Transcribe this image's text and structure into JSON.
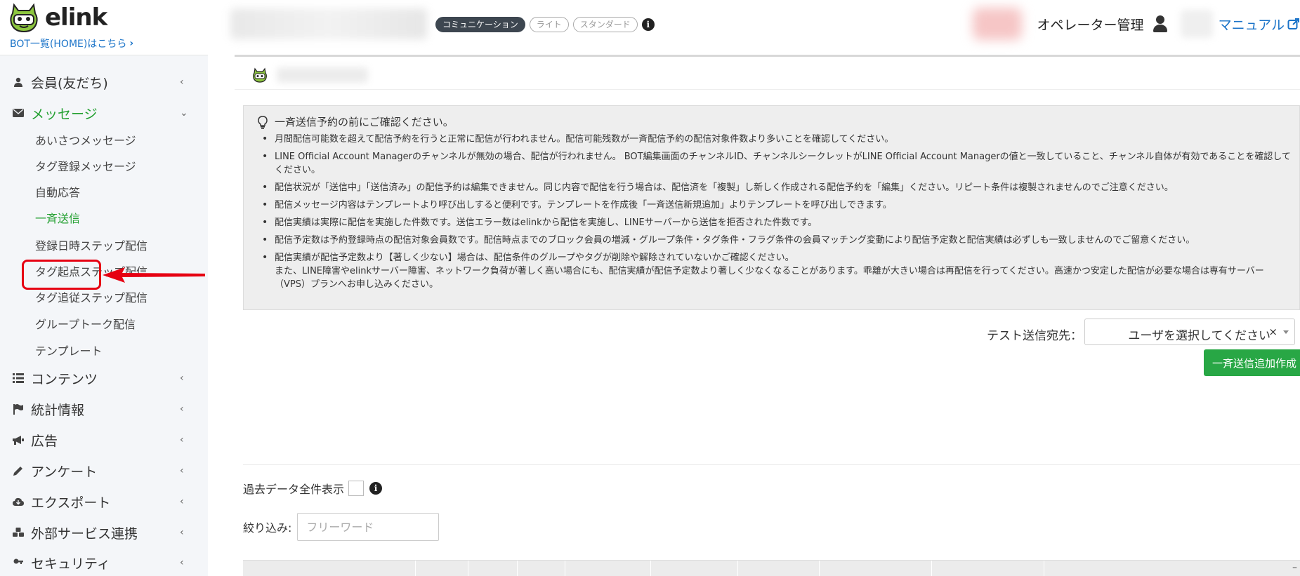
{
  "header": {
    "logo_text": "elink",
    "home_link": "BOT一覧(HOME)はこちら",
    "plans": [
      {
        "label": "コミュニケーション",
        "active": true
      },
      {
        "label": "ライト",
        "active": false
      },
      {
        "label": "スタンダード",
        "active": false
      }
    ],
    "operator_label": "オペレーター管理",
    "manual_label": "マニュアル"
  },
  "sidebar": {
    "items": [
      {
        "label": "会員(友だち)",
        "icon": "user-icon"
      },
      {
        "label": "メッセージ",
        "icon": "envelope-icon"
      },
      {
        "label": "コンテンツ",
        "icon": "list-icon"
      },
      {
        "label": "統計情報",
        "icon": "flag-icon"
      },
      {
        "label": "広告",
        "icon": "megaphone-icon"
      },
      {
        "label": "アンケート",
        "icon": "pencil-icon"
      },
      {
        "label": "エクスポート",
        "icon": "cloud-download-icon"
      },
      {
        "label": "外部サービス連携",
        "icon": "cubes-icon"
      },
      {
        "label": "セキュリティ",
        "icon": "key-icon"
      }
    ],
    "message_sub": [
      "あいさつメッセージ",
      "タグ登録メッセージ",
      "自動応答",
      "一斉送信",
      "登録日時ステップ配信",
      "タグ起点ステップ配信",
      "タグ追従ステップ配信",
      "グループトーク配信",
      "テンプレート"
    ]
  },
  "notice": {
    "title": "一斉送信予約の前にご確認ください。",
    "items": [
      "月間配信可能数を超えて配信予約を行うと正常に配信が行われません。配信可能残数が一斉配信予約の配信対象件数より多いことを確認してください。",
      "LINE Official Account Managerのチャンネルが無効の場合、配信が行われません。 BOT編集画面のチャンネルID、チャンネルシークレットがLINE Official Account Managerの値と一致していること、チャンネル自体が有効であることを確認してください。",
      "配信状況が「送信中」「送信済み」の配信予約は編集できません。同じ内容で配信を行う場合は、配信済を「複製」し新しく作成される配信予約を「編集」ください。リピート条件は複製されませんのでご注意ください。",
      "配信メッセージ内容はテンプレートより呼び出しすると便利です。テンプレートを作成後「一斉送信新規追加」よりテンプレートを呼び出しできます。",
      "配信実績は実際に配信を実施した件数です。送信エラー数はelinkから配信を実施し、LINEサーバーから送信を拒否された件数です。",
      "配信予定数は予約登録時点の配信対象会員数です。配信時点までのブロック会員の増減・グループ条件・タグ条件・フラグ条件の会員マッチング変動により配信予定数と配信実績は必ずしも一致しませんのでご留意ください。",
      "配信実績が配信予定数より【著しく少ない】場合は、配信条件のグループやタグが削除や解除されていないかご確認ください。\nまた、LINE障害やelinkサーバー障害、ネットワーク負荷が著しく高い場合にも、配信実績が配信予定数より著しく少なくなることがあります。乖離が大きい場合は再配信を行ってください。高速かつ安定した配信が必要な場合は専有サーバー（VPS）プランへお申し込みください。"
    ]
  },
  "test_send": {
    "label": "テスト送信宛先：",
    "placeholder": "ユーザを選択してください",
    "clear": "×"
  },
  "add_button": "一斉送信追加作成",
  "past_data_label": "過去データ全件表示",
  "filter": {
    "label": "絞り込み:",
    "placeholder": "フリーワード"
  },
  "colors": {
    "accent_green": "#23a031",
    "button_green": "#28a745",
    "link_blue": "#1a73c8",
    "highlight_red": "#e60012"
  }
}
